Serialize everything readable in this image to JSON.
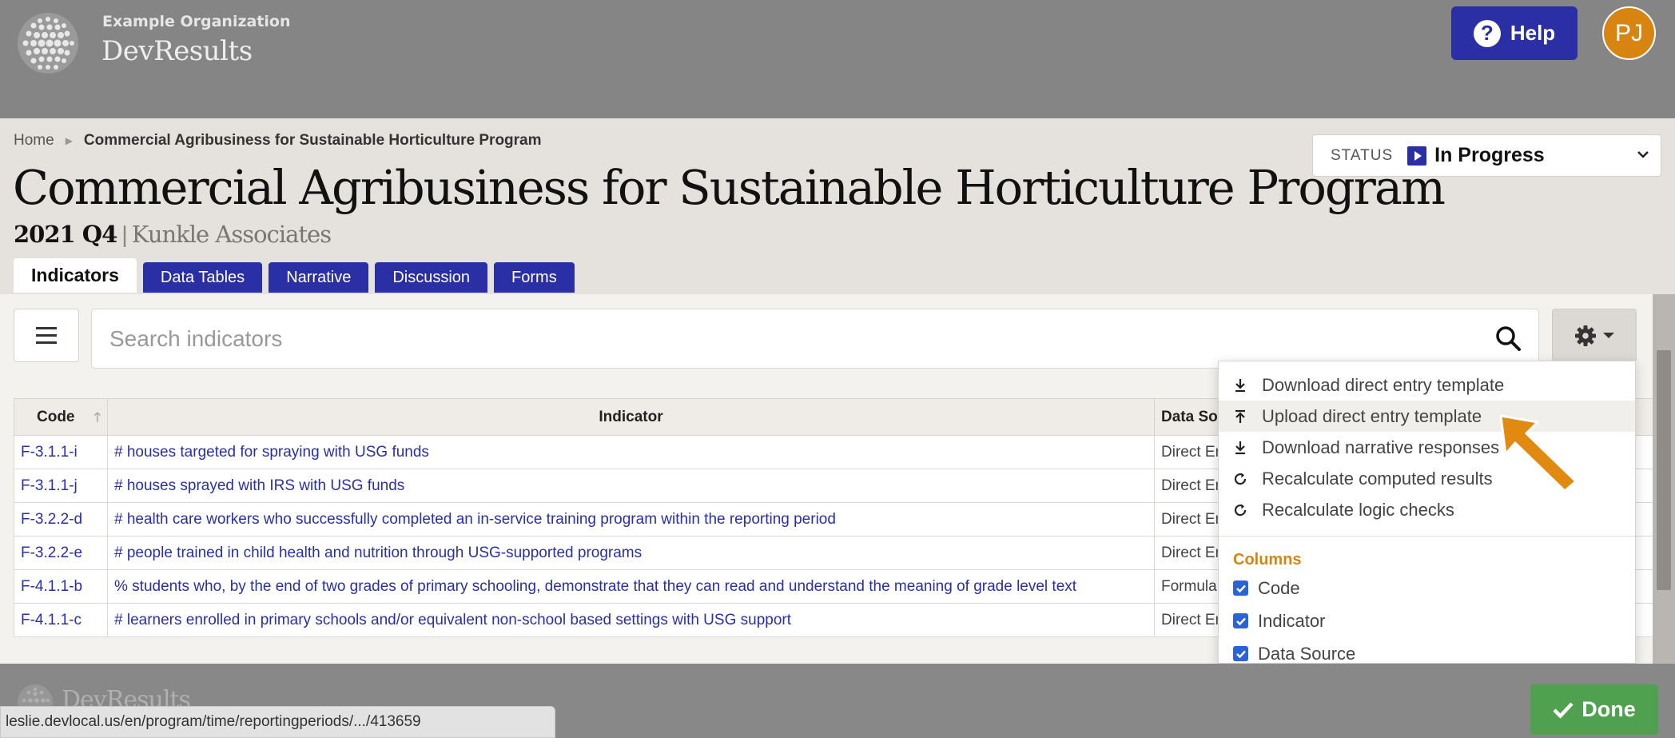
{
  "header": {
    "org_name": "Example Organization",
    "app_name": "DevResults",
    "help_label": "Help",
    "user_initials": "PJ"
  },
  "breadcrumb": {
    "home": "Home",
    "current": "Commercial Agribusiness for Sustainable Horticulture Program"
  },
  "status": {
    "label": "STATUS",
    "value": "In Progress"
  },
  "program": {
    "title": "Commercial Agribusiness for Sustainable Horticulture Program",
    "period": "2021 Q4",
    "separator": "|",
    "organization": "Kunkle Associates"
  },
  "tabs": [
    {
      "label": "Indicators",
      "active": true
    },
    {
      "label": "Data Tables",
      "active": false
    },
    {
      "label": "Narrative",
      "active": false
    },
    {
      "label": "Discussion",
      "active": false
    },
    {
      "label": "Forms",
      "active": false
    }
  ],
  "search": {
    "placeholder": "Search indicators"
  },
  "table": {
    "headers": [
      "Code",
      "Indicator",
      "Data Source"
    ],
    "rows": [
      {
        "code": "F-3.1.1-i",
        "indicator": "# houses targeted for spraying with USG funds",
        "source": "Direct Entry"
      },
      {
        "code": "F-3.1.1-j",
        "indicator": "# houses sprayed with IRS with USG funds",
        "source": "Direct Entry"
      },
      {
        "code": "F-3.2.2-d",
        "indicator": "# health care workers who successfully completed an in-service training program within the reporting period",
        "source": "Direct Entry"
      },
      {
        "code": "F-3.2.2-e",
        "indicator": "# people trained in child health and nutrition through USG-supported programs",
        "source": "Direct Entry"
      },
      {
        "code": "F-4.1.1-b",
        "indicator": "% students who, by the end of two grades of primary schooling, demonstrate that they can read and understand the meaning of grade level text",
        "source": "Formula"
      },
      {
        "code": "F-4.1.1-c",
        "indicator": "# learners enrolled in primary schools and/or equivalent non-school based settings with USG support",
        "source": "Direct Entry"
      }
    ]
  },
  "dropdown": {
    "actions": [
      {
        "label": "Download direct entry template",
        "icon": "download-icon"
      },
      {
        "label": "Upload direct entry template",
        "icon": "upload-icon"
      },
      {
        "label": "Download narrative responses",
        "icon": "download-icon"
      },
      {
        "label": "Recalculate computed results",
        "icon": "refresh-icon"
      },
      {
        "label": "Recalculate logic checks",
        "icon": "refresh-icon"
      }
    ],
    "columns_heading": "Columns",
    "columns": [
      {
        "label": "Code",
        "checked": true
      },
      {
        "label": "Indicator",
        "checked": true
      },
      {
        "label": "Data Source",
        "checked": true
      }
    ]
  },
  "footer": {
    "app_name": "DevResults",
    "url": "leslie.devlocal.us/en/program/time/reportingperiods/.../413659",
    "done_label": "Done"
  },
  "colors": {
    "primary": "#2a2fa6",
    "accent": "#d88410",
    "success": "#4fa14f",
    "checkbox": "#2a63d6"
  }
}
